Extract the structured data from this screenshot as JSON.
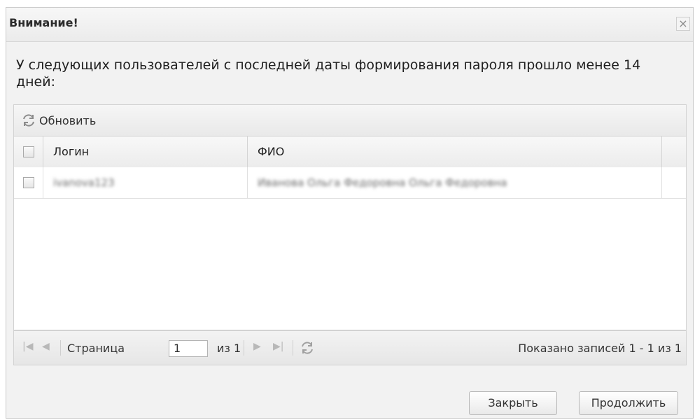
{
  "dialog": {
    "title": "Внимание!",
    "close_symbol": "×",
    "message": "У следующих пользователей с последней даты формирования пароля прошло менее 14 дней:"
  },
  "toolbar": {
    "refresh_label": "Обновить",
    "refresh_icon": "refresh-icon"
  },
  "grid": {
    "columns": [
      "Логин",
      "ФИО"
    ],
    "rows": [
      {
        "login": "ivanova123",
        "fio": "Иванова Ольга Федоровна Ольга Федоровна"
      }
    ]
  },
  "pager": {
    "page_label": "Страница",
    "page_value": "1",
    "of_label": "из 1",
    "records_text": "Показано записей 1 - 1 из 1"
  },
  "buttons": {
    "close": "Закрыть",
    "continue": "Продолжить"
  },
  "colors": {
    "window_bg": "#f2f2f2",
    "icon_grey": "#9a9a9a"
  }
}
